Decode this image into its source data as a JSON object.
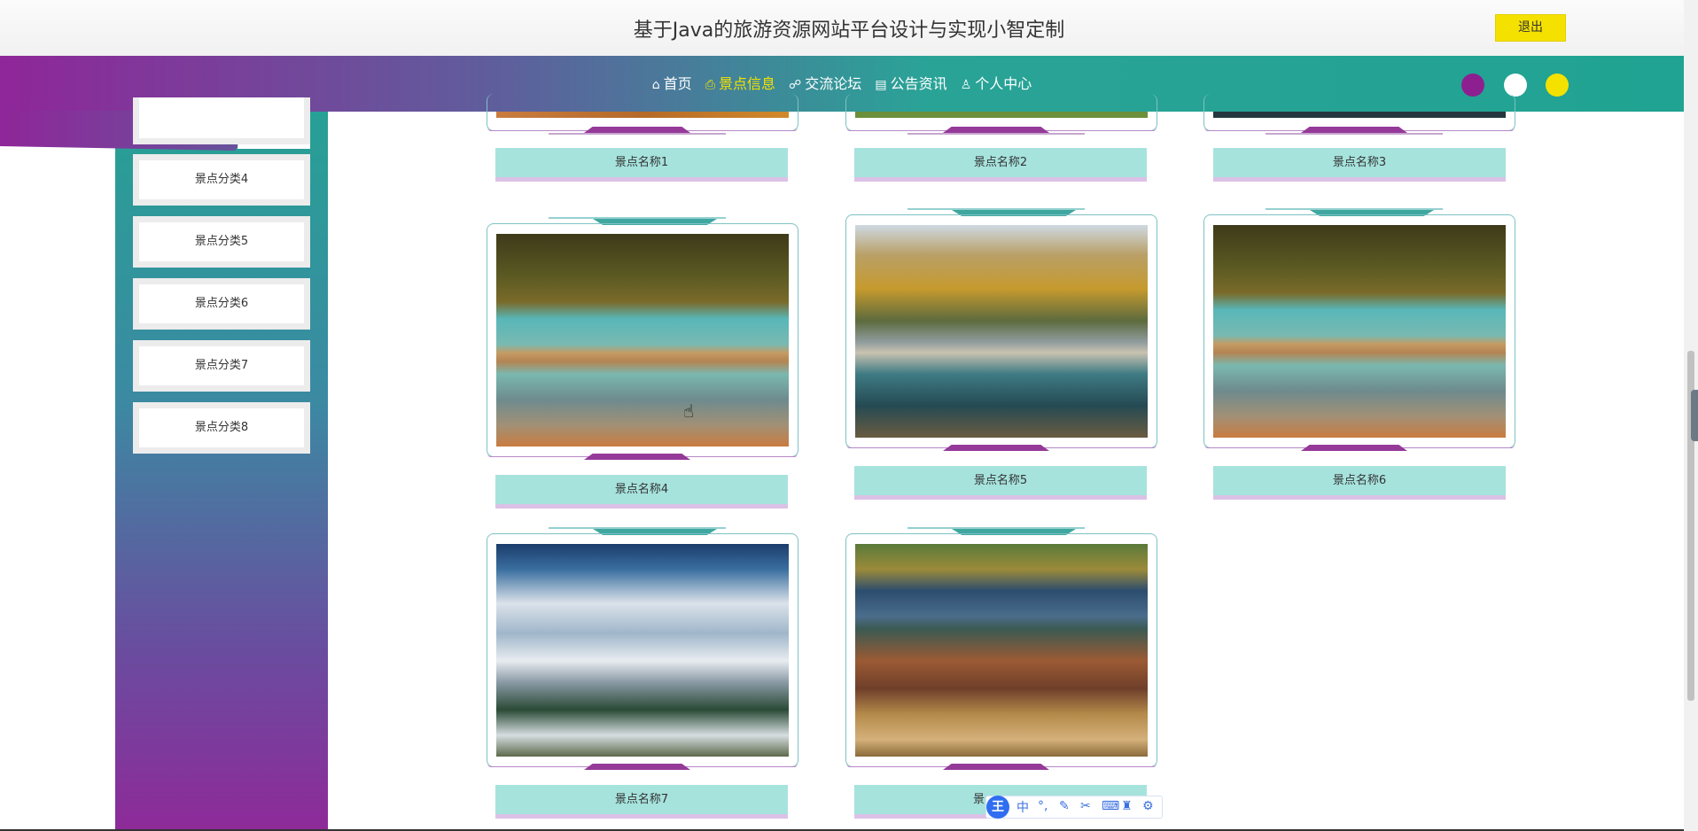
{
  "header": {
    "site_title": "基于Java的旅游资源网站平台设计与实现小智定制",
    "logout_label": "退出"
  },
  "nav": {
    "items": [
      {
        "label": "首页",
        "icon": "home-icon"
      },
      {
        "label": "景点信息",
        "icon": "printer-icon",
        "active": true
      },
      {
        "label": "交流论坛",
        "icon": "forum-icon"
      },
      {
        "label": "公告资讯",
        "icon": "clipboard-icon"
      },
      {
        "label": "个人中心",
        "icon": "user-icon"
      }
    ],
    "theme_dots": [
      "#8e1f91",
      "#ffffff",
      "#f5e100"
    ]
  },
  "sidebar": {
    "categories": [
      "景点分类4",
      "景点分类5",
      "景点分类6",
      "景点分类7",
      "景点分类8"
    ]
  },
  "spots": [
    {
      "name": "景点名称1"
    },
    {
      "name": "景点名称2"
    },
    {
      "name": "景点名称3"
    },
    {
      "name": "景点名称4"
    },
    {
      "name": "景点名称5"
    },
    {
      "name": "景点名称6"
    },
    {
      "name": "景点名称7"
    },
    {
      "name": "景点名称8",
      "visible_text": "景"
    }
  ],
  "ime_toolbar": {
    "logo": "王",
    "mode": "中",
    "icons": [
      "punctuation-icon",
      "pen-icon",
      "scissors-icon",
      "keyboard-icon",
      "shirt-icon",
      "settings-icon"
    ]
  }
}
